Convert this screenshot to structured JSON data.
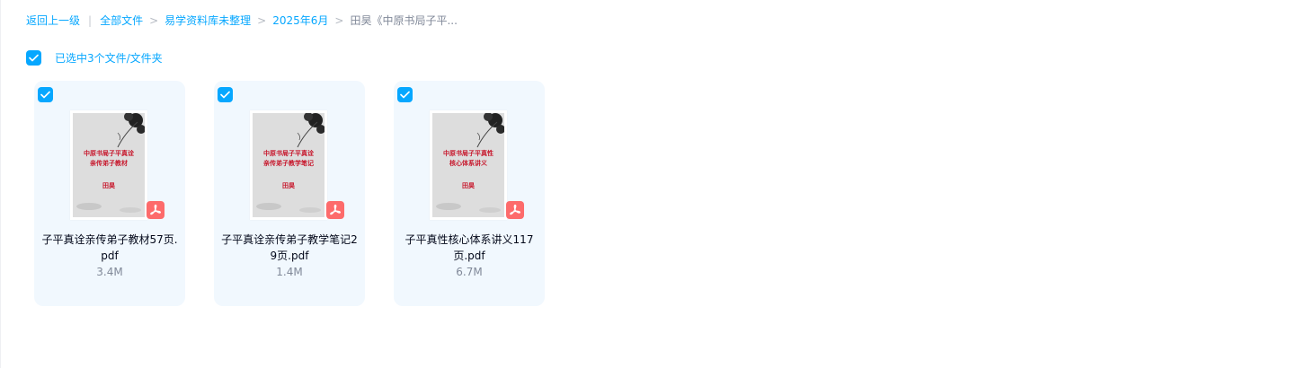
{
  "breadcrumb": {
    "back_label": "返回上一级",
    "items": [
      {
        "label": "全部文件"
      },
      {
        "label": "易学资料库未整理"
      },
      {
        "label": "2025年6月"
      }
    ],
    "current": "田昊《中原书局子平..."
  },
  "selection": {
    "label": "已选中3个文件/文件夹",
    "checked": true
  },
  "colors": {
    "accent": "#06a7ff",
    "card_bg": "#f1f8fe",
    "pdf_badge": "#fd6b6b",
    "thumb_text": "#c7162b"
  },
  "files": [
    {
      "name": "子平真诠亲传弟子教材57页.pdf",
      "size": "3.4M",
      "type_icon": "pdf-icon",
      "selected": true,
      "thumbnail": {
        "title_lines": [
          "中原书局子平真诠",
          "亲传弟子教材"
        ],
        "author": "田昊"
      }
    },
    {
      "name": "子平真诠亲传弟子教学笔记29页.pdf",
      "size": "1.4M",
      "type_icon": "pdf-icon",
      "selected": true,
      "thumbnail": {
        "title_lines": [
          "中原书局子平真诠",
          "亲传弟子教学笔记"
        ],
        "author": "田昊"
      }
    },
    {
      "name": "子平真性核心体系讲义117页.pdf",
      "size": "6.7M",
      "type_icon": "pdf-icon",
      "selected": true,
      "thumbnail": {
        "title_lines": [
          "中原书局子平真性",
          "核心体系讲义"
        ],
        "author": "田昊"
      }
    }
  ]
}
